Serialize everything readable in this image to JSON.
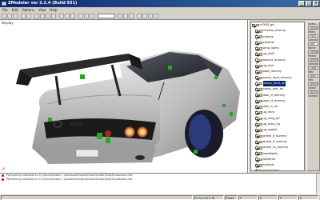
{
  "window": {
    "title": "ZModeler ver 2.2.4 (Build 931)",
    "minimize": "_",
    "maximize": "□",
    "close": "×"
  },
  "menu": [
    "File",
    "Edit",
    "Options",
    "View",
    "Help"
  ],
  "viewport": {
    "label": "Display"
  },
  "tree": {
    "items": [
      {
        "label": "rx7fd3_gtr",
        "checked": true
      },
      {
        "label": "chassis_dummy",
        "checked": true
      },
      {
        "label": "chassis",
        "checked": true
      },
      {
        "label": "exhaust",
        "checked": true
      },
      {
        "label": "wing_lights",
        "checked": true
      },
      {
        "label": "ug_stuff",
        "checked": true
      },
      {
        "label": "bonnet_dummy",
        "checked": true
      },
      {
        "label": "ug_roof",
        "checked": true
      },
      {
        "label": "boot_dummy",
        "checked": true
      },
      {
        "label": "bump_front_dummy",
        "checked": true
      },
      {
        "label": "bump_front_ok",
        "checked": true,
        "selected": true
      },
      {
        "label": "bump_rear_ok",
        "checked": true
      },
      {
        "label": "door_lf_dummy",
        "checked": true
      },
      {
        "label": "door_rf_dummy",
        "checked": true
      },
      {
        "label": "door_lr_ok",
        "checked": true
      },
      {
        "label": "ug_nitro",
        "checked": true
      },
      {
        "label": "ug_wing_lef",
        "checked": true
      },
      {
        "label": "ug_wing_rig",
        "checked": true
      },
      {
        "label": "ug_spoiler",
        "checked": true
      },
      {
        "label": "wheel_lf_dummy",
        "checked": true
      },
      {
        "label": "wheel_rf_dummy",
        "checked": true
      },
      {
        "label": "wheel_rb_dummy",
        "checked": true
      },
      {
        "label": "headlights",
        "checked": true
      },
      {
        "label": "taillights",
        "checked": true
      },
      {
        "label": "exhaust",
        "checked": true
      },
      {
        "label": "windscreen",
        "checked": true
      },
      {
        "label": "engine",
        "checked": true
      },
      {
        "label": "petrolcap",
        "checked": true
      },
      {
        "label": "misc_a",
        "checked": true
      },
      {
        "label": "shadow",
        "checked": true
      }
    ]
  },
  "props": [
    "Editor...",
    "Display",
    "Effect",
    "Pivot",
    "Connect",
    "Edit",
    "Name",
    "Visible",
    "Parent",
    "Select",
    "Collision",
    "Flags",
    "Misc",
    "Tools",
    "Info",
    "Settings",
    "Select",
    "Texture",
    "Surface"
  ],
  "log": [
    "Performing autosave to C:\\Users\\Sutton\\...\\AutosaveEngine\\ExtA1\\ExtA2\\ExtA3\\autosave.z3d",
    "Performing autosave to C:\\Users\\Sutton\\...\\AutosaveEngine\\ExtA1\\ExtA2\\ExtA3\\autosave.z3d"
  ],
  "status": {
    "left": "",
    "coords": "0.0;0.0;0.0 W",
    "mode": "Node",
    "c1": "0",
    "c2": "0",
    "c3": "0",
    "c4": "0"
  },
  "colors": {
    "car_body": "#c8c8c8",
    "wing": "#2a2a2a",
    "tail_light": "#ffb060",
    "dummy_marker": "#22aa22",
    "selection": "#0a246a"
  }
}
